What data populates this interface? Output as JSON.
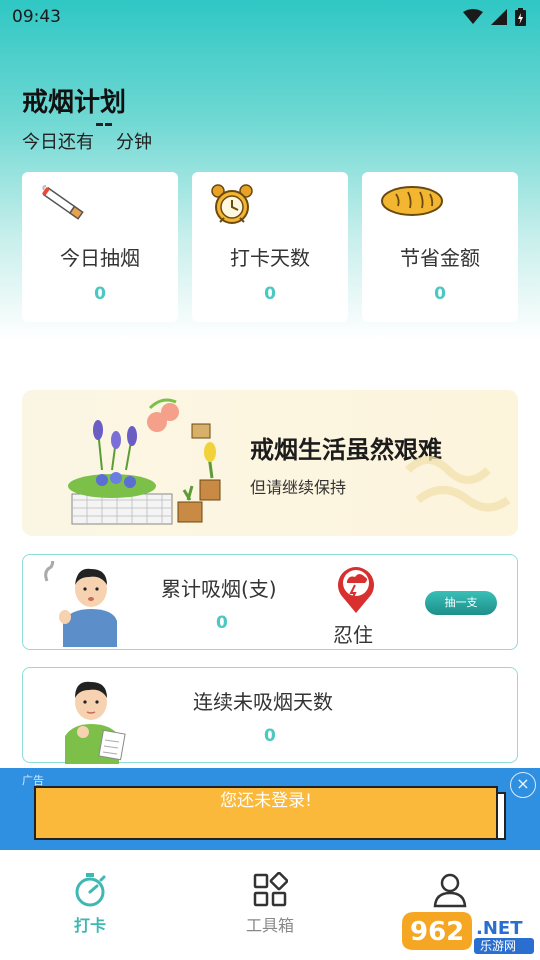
{
  "status_bar": {
    "time": "09:43"
  },
  "header": {
    "title": "戒烟计划",
    "subtitle_prefix": "今日还有",
    "subtitle_suffix": "分钟"
  },
  "stats": [
    {
      "label": "今日抽烟",
      "value": "0",
      "icon": "cigarette-icon"
    },
    {
      "label": "打卡天数",
      "value": "0",
      "icon": "alarm-clock-icon"
    },
    {
      "label": "节省金额",
      "value": "0",
      "icon": "bread-icon"
    }
  ],
  "banner": {
    "title": "戒烟生活虽然艰难",
    "subtitle": "但请继续保持"
  },
  "cumulative_card": {
    "label": "累计吸烟(支)",
    "value": "0",
    "resist_label": "忍住",
    "smoke_button": "抽一支"
  },
  "streak_card": {
    "label": "连续未吸烟天数",
    "value": "0"
  },
  "ad": {
    "label": "广告",
    "message": "您还未登录!"
  },
  "nav": {
    "items": [
      {
        "label": "打卡",
        "active": true,
        "icon": "stopwatch-icon"
      },
      {
        "label": "工具箱",
        "active": false,
        "icon": "grid-icon"
      },
      {
        "label": "",
        "active": false,
        "icon": "user-icon"
      }
    ]
  },
  "colors": {
    "accent": "#4cc7c2",
    "header_gradient_top": "#2fc7c4",
    "ad_background": "#2f8fe0",
    "ad_box": "#fbb93c"
  }
}
